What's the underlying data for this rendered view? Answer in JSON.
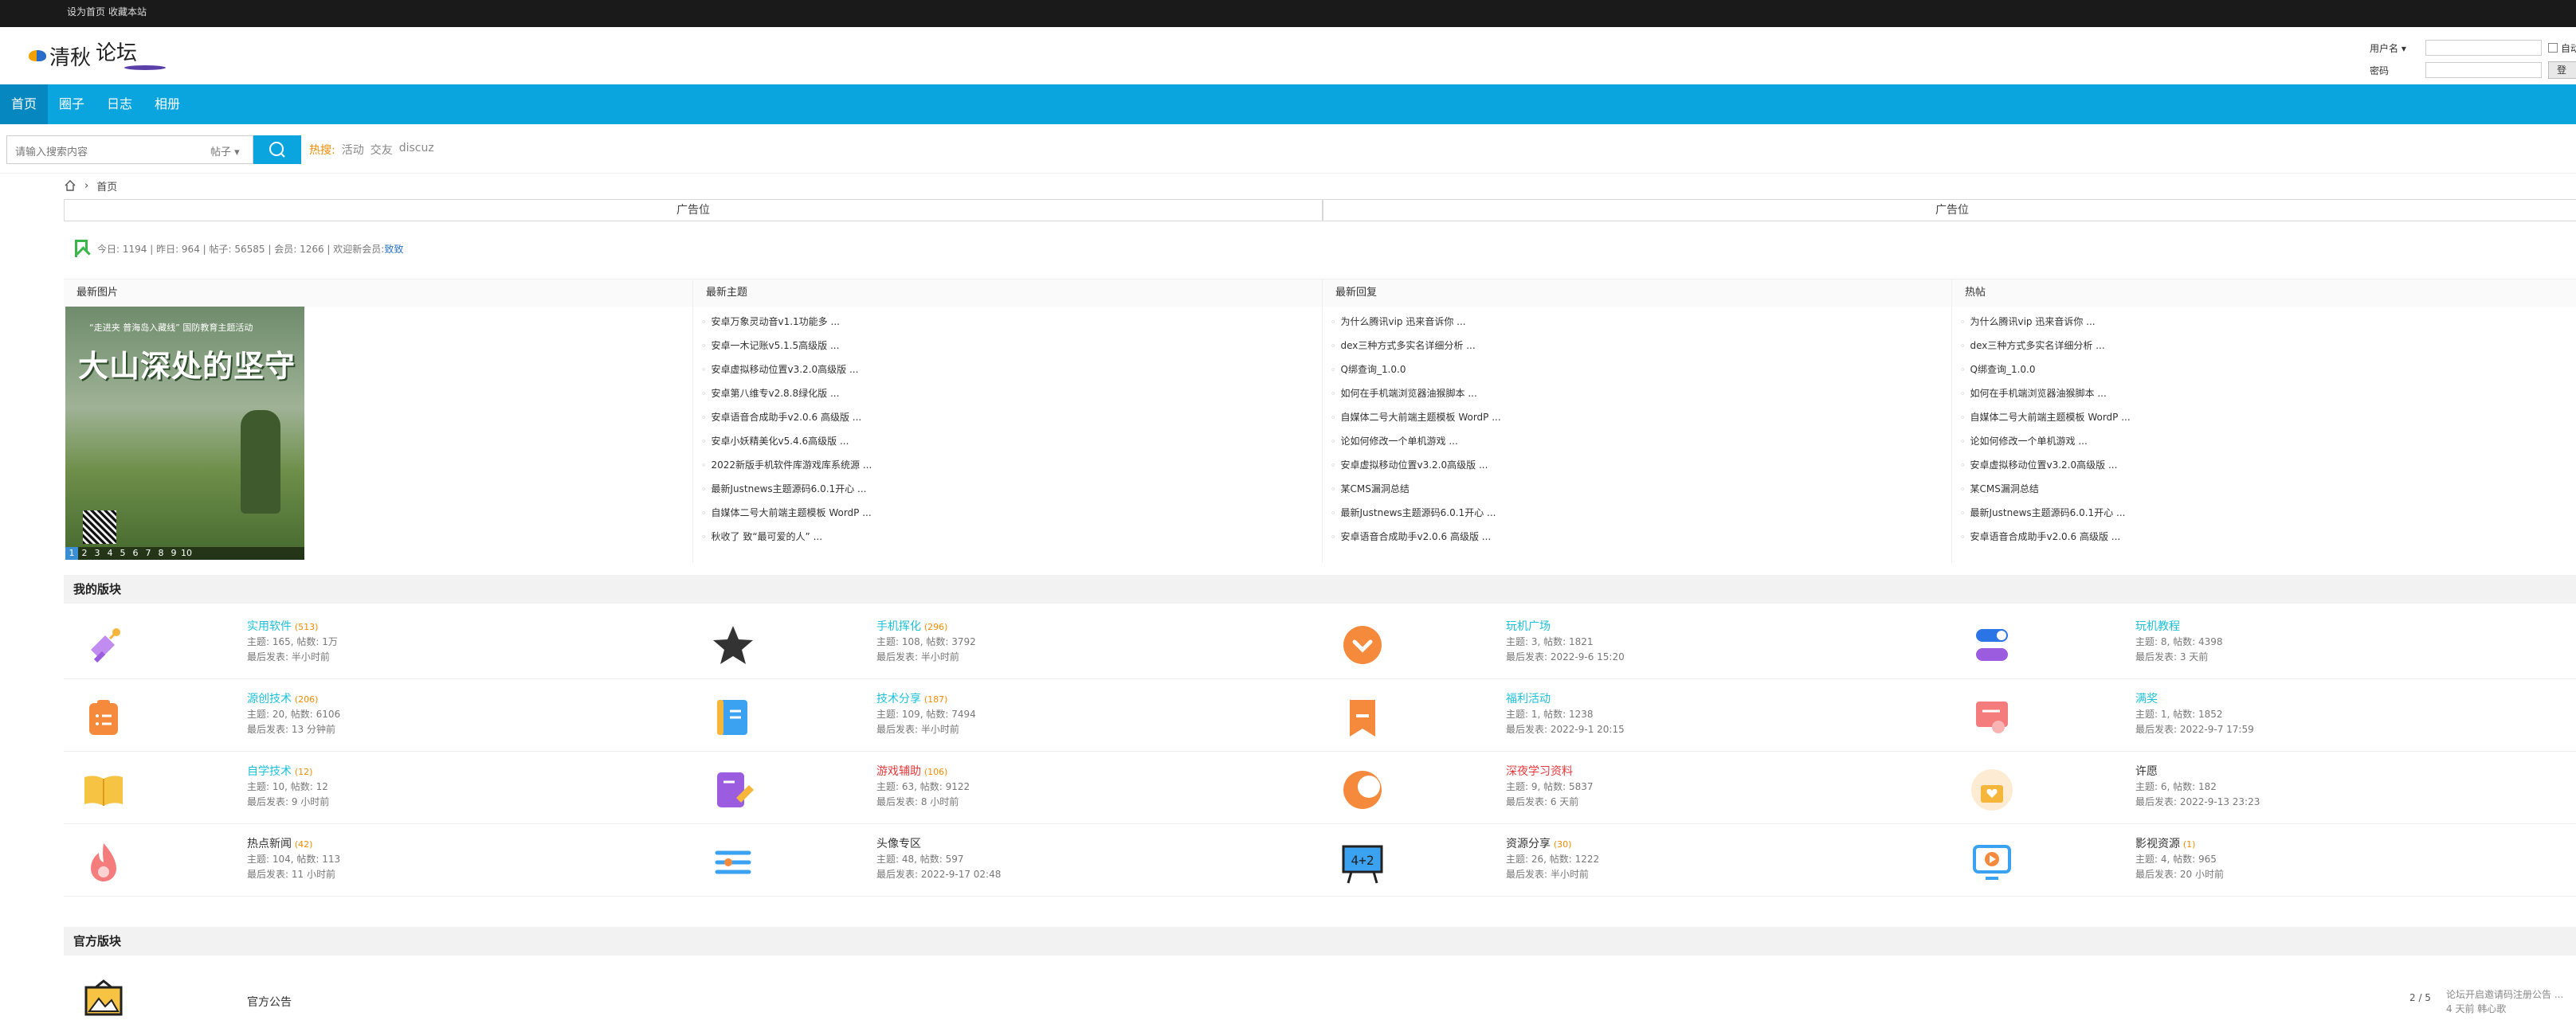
{
  "topbar": {
    "set_home": "设为首页",
    "bookmark": "收藏本站"
  },
  "logo": {
    "part1": "清秋",
    "part2": "论坛"
  },
  "login": {
    "username_label": "用户名",
    "password_label": "密码",
    "auto_label": "自动",
    "login_button": "登"
  },
  "nav": [
    {
      "label": "首页"
    },
    {
      "label": "圈子"
    },
    {
      "label": "日志"
    },
    {
      "label": "相册"
    }
  ],
  "search": {
    "placeholder": "请输入搜索内容",
    "type": "帖子",
    "hot_label": "热搜:",
    "hot_terms": [
      "活动",
      "交友",
      "discuz"
    ]
  },
  "breadcrumb": {
    "home": "首页"
  },
  "ads": [
    "广告位",
    "广告位"
  ],
  "stats": {
    "text": "今日: 1194 | 昨日: 964 | 帖子: 56585 | 会员: 1266 | 欢迎新会员: ",
    "new_member": "致致"
  },
  "columns": {
    "latest_images": {
      "title": "最新图片"
    },
    "latest_threads": {
      "title": "最新主题",
      "items": [
        "安卓万象灵动音v1.1功能多 ...",
        "安卓一木记账v5.1.5高级版 ...",
        "安卓虚拟移动位置v3.2.0高级版 ...",
        "安卓第八维专v2.8.8绿化版 ...",
        "安卓语音合成助手v2.0.6 高级版 ...",
        "安卓小妖精美化v5.4.6高级版 ...",
        "2022新版手机软件库游戏库系统源 ...",
        "最新Justnews主题源码6.0.1开心 ...",
        "自媒体二号大前端主题模板 WordP ...",
        "秋收了 致“最可爱的人” ..."
      ]
    },
    "latest_replies": {
      "title": "最新回复",
      "items": [
        "为什么腾讯vip 迅来音诉你 ...",
        "dex三种方式多实名详细分析 ...",
        "Q绑查询_1.0.0",
        "如何在手机端浏览器油猴脚本 ...",
        "自媒体二号大前端主题模板 WordP ...",
        "论如何修改一个单机游戏 ...",
        "安卓虚拟移动位置v3.2.0高级版 ...",
        "某CMS漏洞总结",
        "最新Justnews主题源码6.0.1开心 ...",
        "安卓语音合成助手v2.0.6 高级版 ..."
      ]
    },
    "hot": {
      "title": "热帖",
      "items": [
        "为什么腾讯vip 迅来音诉你 ...",
        "dex三种方式多实名详细分析 ...",
        "Q绑查询_1.0.0",
        "如何在手机端浏览器油猴脚本 ...",
        "自媒体二号大前端主题模板 WordP ...",
        "论如何修改一个单机游戏 ...",
        "安卓虚拟移动位置v3.2.0高级版 ...",
        "某CMS漏洞总结",
        "最新Justnews主题源码6.0.1开心 ...",
        "安卓语音合成助手v2.0.6 高级版 ..."
      ]
    }
  },
  "slideshow": {
    "subtitle": "“走进夹 普海岛入藏线” 国防教育主题活动",
    "title": "大山深处的坚守",
    "pages": [
      "1",
      "2",
      "3",
      "4",
      "5",
      "6",
      "7",
      "8",
      "9",
      "10"
    ]
  },
  "my_forums_title": "我的版块",
  "forums": [
    [
      {
        "name": "实用软件",
        "count": "(513)",
        "stats": "主题: 165, 帖数: 1万",
        "last": "最后发表: 半小时前",
        "icon": "satellite-icon",
        "style": "cyan"
      },
      {
        "name": "手机挥化",
        "count": "(296)",
        "stats": "主题: 108, 帖数: 3792",
        "last": "最后发表: 半小时前",
        "icon": "star-icon",
        "style": "cyan"
      },
      {
        "name": "玩机广场",
        "count": "",
        "stats": "主题: 3, 帖数: 1821",
        "last": "最后发表: 2022-9-6 15:20",
        "icon": "chevron-circle-icon",
        "style": "cyan"
      },
      {
        "name": "玩机教程",
        "count": "",
        "stats": "主题: 8, 帖数: 4398",
        "last": "最后发表: 3 天前",
        "icon": "toggle-icon",
        "style": "cyan"
      }
    ],
    [
      {
        "name": "源创技术",
        "count": "(206)",
        "stats": "主题: 20, 帖数: 6106",
        "last": "最后发表: 13 分钟前",
        "icon": "clipboard-icon",
        "style": "cyan"
      },
      {
        "name": "技术分享",
        "count": "(187)",
        "stats": "主题: 109, 帖数: 7494",
        "last": "最后发表: 半小时前",
        "icon": "notebook-icon",
        "style": "cyan"
      },
      {
        "name": "福利活动",
        "count": "",
        "stats": "主题: 1, 帖数: 1238",
        "last": "最后发表: 2022-9-1 20:15",
        "icon": "bookmark-icon",
        "style": "cyan"
      },
      {
        "name": "满奖",
        "count": "",
        "stats": "主题: 1, 帖数: 1852",
        "last": "最后发表: 2022-9-7 17:59",
        "icon": "certificate-icon",
        "style": "cyan"
      }
    ],
    [
      {
        "name": "自学技术",
        "count": "(12)",
        "stats": "主题: 10, 帖数: 12",
        "last": "最后发表: 9 小时前",
        "icon": "book-icon",
        "style": "cyan"
      },
      {
        "name": "游戏辅助",
        "count": "(106)",
        "stats": "主题: 63, 帖数: 9122",
        "last": "最后发表: 8 小时前",
        "icon": "edit-icon",
        "style": "red"
      },
      {
        "name": "深夜学习资料",
        "count": "",
        "stats": "主题: 9, 帖数: 5837",
        "last": "最后发表: 6 天前",
        "icon": "moon-icon",
        "style": "red"
      },
      {
        "name": "许愿",
        "count": "",
        "stats": "主题: 6, 帖数: 182",
        "last": "最后发表: 2022-9-13 23:23",
        "icon": "wish-icon",
        "style": "dark"
      }
    ],
    [
      {
        "name": "热点新闻",
        "count": "(42)",
        "stats": "主题: 104, 帖数: 113",
        "last": "最后发表: 11 小时前",
        "icon": "flame-icon",
        "style": "dark"
      },
      {
        "name": "头像专区",
        "count": "",
        "stats": "主题: 48, 帖数: 597",
        "last": "最后发表: 2022-9-17 02:48",
        "icon": "sliders-icon",
        "style": "dark"
      },
      {
        "name": "资源分享",
        "count": "(30)",
        "stats": "主题: 26, 帖数: 1222",
        "last": "最后发表: 半小时前",
        "icon": "blackboard-icon",
        "style": "dark"
      },
      {
        "name": "影视资源",
        "count": "(1)",
        "stats": "主题: 4, 帖数: 965",
        "last": "最后发表: 20 小时前",
        "icon": "play-screen-icon",
        "style": "dark"
      }
    ]
  ],
  "official_title": "官方版块",
  "official": {
    "name": "官方公告",
    "pages": "2 / 5",
    "last_title": "论坛开启邀请码注册公告 ...",
    "last_time": "4 天前 韩心歌"
  },
  "colors": {
    "nav": "#0aa4de",
    "nav_active": "#0787bf",
    "forum_cyan": "#1ec0d8",
    "forum_red": "#e5383b",
    "count": "#f48b00"
  }
}
